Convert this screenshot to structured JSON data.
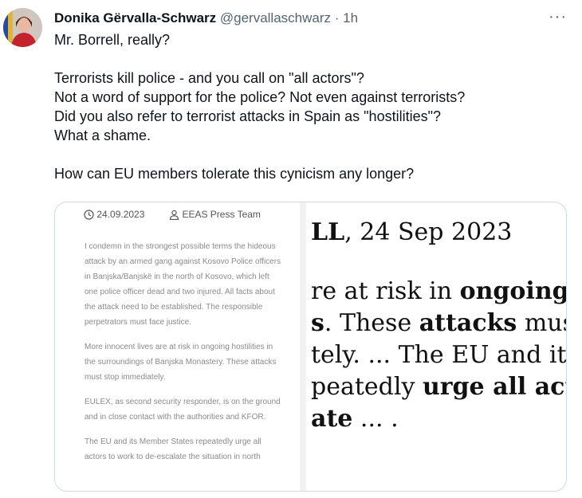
{
  "tweet": {
    "author_name": "Donika Gërvalla-Schwarz",
    "author_handle": "@gervallaschwarz",
    "separator": "·",
    "time": "1h",
    "more_icon": "more-dots-icon",
    "body": "Mr. Borrell, really?\n\nTerrorists kill police - and you call on \"all  actors\"?\nNot a word of support for the police? Not even against terrorists?\nDid you also refer to terrorist attacks in Spain as \"hostilities\"?\nWhat a shame.\n\nHow can EU members tolerate this cynicism any longer?"
  },
  "card": {
    "date": "24.09.2023",
    "author": "EEAS Press Team",
    "paragraphs": [
      "I condemn in the strongest possible terms the hideous attack by an armed gang against Kosovo Police officers in Banjska/Banjskë in the north of Kosovo, which left one police officer dead and two injured. All facts about the attack need to be established. The responsible perpetrators must face justice.",
      "More innocent lives are at risk in ongoing hostilities in the surroundings of Banjska Monastery. These attacks must stop immediately.",
      "EULEX, as second security responder, is on the ground and in close contact with the authorities and KFOR.",
      "The EU and its Member States repeatedly urge all actors to work to de-escalate the situation in north"
    ],
    "zoom": {
      "line1_a": "LL",
      "line1_b": ", 24 Sep 2023",
      "line2_a": "re at risk in ",
      "line2_b": "ongoing",
      "line3_a": "s",
      "line3_b": ". These ",
      "line3_c": "attacks",
      "line3_d": " must st",
      "line4": "tely. ... The EU and its M",
      "line5_a": "peatedly ",
      "line5_b": "urge all actors",
      "line6_a": "ate",
      "line6_b": " ... ."
    }
  },
  "colors": {
    "text": "#0f1419",
    "muted": "#536471",
    "border": "#cfd9de"
  }
}
